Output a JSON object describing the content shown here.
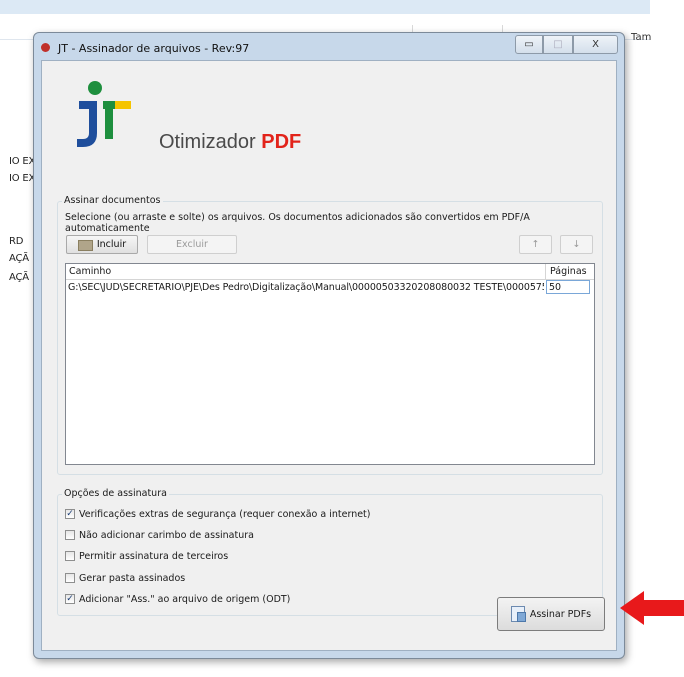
{
  "background": {
    "right_text": "Tam",
    "left_fragments": [
      "IO EX",
      "IO EX",
      "RD",
      "AÇÃ",
      "AÇÃ"
    ]
  },
  "window": {
    "title": "JT - Assinador de arquivos - Rev:97",
    "minimize_glyph": "▭",
    "maximize_glyph": "□",
    "close_glyph": "X"
  },
  "logo": {
    "text": "Otimizador",
    "accent": "PDF",
    "colors": {
      "green": "#1e8f3e",
      "blue": "#1f4e9c",
      "yellow": "#f5c400",
      "red": "#e2231a"
    }
  },
  "documents": {
    "group_title": "Assinar documentos",
    "instruction": "Selecione (ou arraste e solte) os arquivos. Os documentos adicionados são convertidos em PDF/A automaticamente",
    "include_label": "Incluir",
    "exclude_label": "Excluir",
    "up_glyph": "↑",
    "down_glyph": "↓",
    "columns": {
      "path": "Caminho",
      "pages": "Páginas"
    },
    "rows": [
      {
        "path": "G:\\SEC\\JUD\\SECRETARIO\\PJE\\Des Pedro\\Digitalização\\Manual\\00000503320208080032 TESTE\\0000575...",
        "pages": "50"
      }
    ]
  },
  "options": {
    "group_title": "Opções de assinatura",
    "items": [
      {
        "label": "Verificações extras de segurança (requer conexão a internet)",
        "checked": true
      },
      {
        "label": "Não adicionar carimbo de assinatura",
        "checked": false
      },
      {
        "label": "Permitir assinatura de terceiros",
        "checked": false
      },
      {
        "label": "Gerar pasta assinados",
        "checked": false
      },
      {
        "label": "Adicionar \"Ass.\" ao arquivo de origem (ODT)",
        "checked": true
      }
    ]
  },
  "sign_button": {
    "label": "Assinar PDFs"
  },
  "annotation": {
    "arrow_color": "#e8191b"
  }
}
